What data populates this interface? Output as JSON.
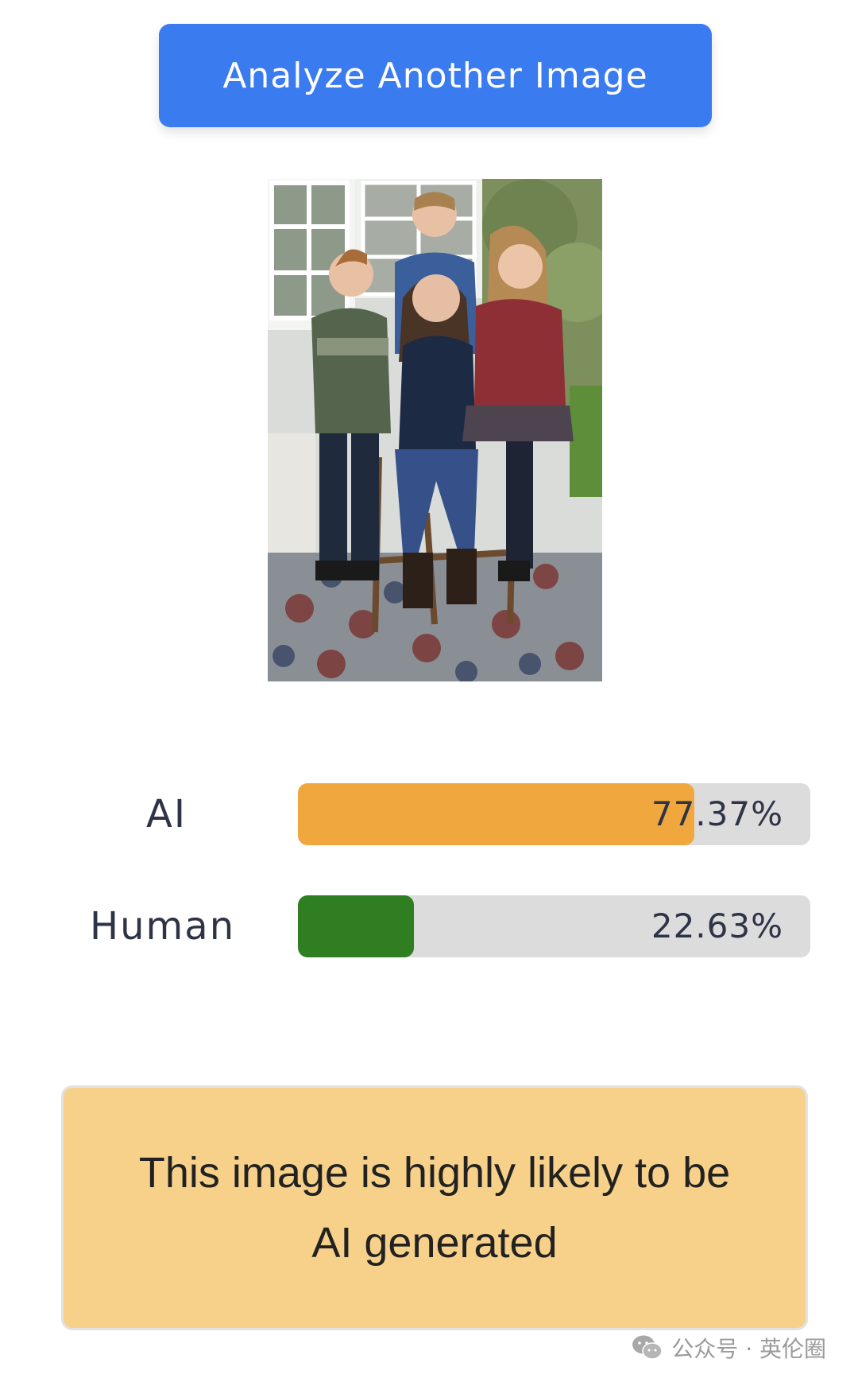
{
  "header": {
    "analyze_button_label": "Analyze Another Image"
  },
  "photo": {
    "icon": "family-photo-image"
  },
  "results": [
    {
      "label": "AI",
      "value_text": "77.37%",
      "fraction": 0.7737,
      "color": "#f0a73d"
    },
    {
      "label": "Human",
      "value_text": "22.63%",
      "fraction": 0.2263,
      "color": "#2f7f22"
    }
  ],
  "verdict": {
    "text": "This image is highly likely to be AI generated",
    "background": "#f7d18a"
  },
  "watermark": {
    "icon": "wechat-icon",
    "text": "公众号 · 英伦圈"
  }
}
